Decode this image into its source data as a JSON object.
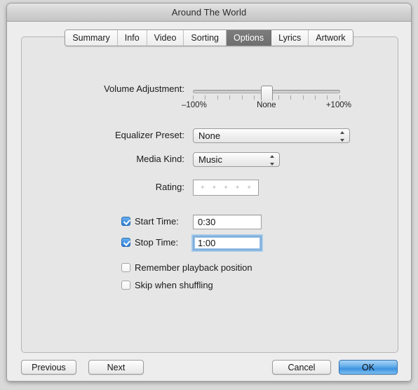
{
  "window": {
    "title": "Around The World"
  },
  "tabs": [
    {
      "label": "Summary",
      "active": false
    },
    {
      "label": "Info",
      "active": false
    },
    {
      "label": "Video",
      "active": false
    },
    {
      "label": "Sorting",
      "active": false
    },
    {
      "label": "Options",
      "active": true
    },
    {
      "label": "Lyrics",
      "active": false
    },
    {
      "label": "Artwork",
      "active": false
    }
  ],
  "options": {
    "volume": {
      "label": "Volume Adjustment:",
      "min_label": "–100%",
      "center_label": "None",
      "max_label": "+100%",
      "value": "None",
      "tick_count": 13
    },
    "equalizer": {
      "label": "Equalizer Preset:",
      "value": "None"
    },
    "media_kind": {
      "label": "Media Kind:",
      "value": "Music"
    },
    "rating": {
      "label": "Rating:",
      "stars": 5,
      "value": ""
    },
    "start_time": {
      "label": "Start Time:",
      "checked": true,
      "value": "0:30"
    },
    "stop_time": {
      "label": "Stop Time:",
      "checked": true,
      "value": "1:00",
      "focused": true
    },
    "remember_position": {
      "label": "Remember playback position",
      "checked": false
    },
    "skip_shuffling": {
      "label": "Skip when shuffling",
      "checked": false
    }
  },
  "footer": {
    "previous": "Previous",
    "next": "Next",
    "cancel": "Cancel",
    "ok": "OK"
  },
  "colors": {
    "accent_blue": "#3f93e0",
    "checkbox_blue": "#2f7fd4",
    "focus_ring": "#a8cdec",
    "tab_active_bg": "#6e6e6e"
  }
}
